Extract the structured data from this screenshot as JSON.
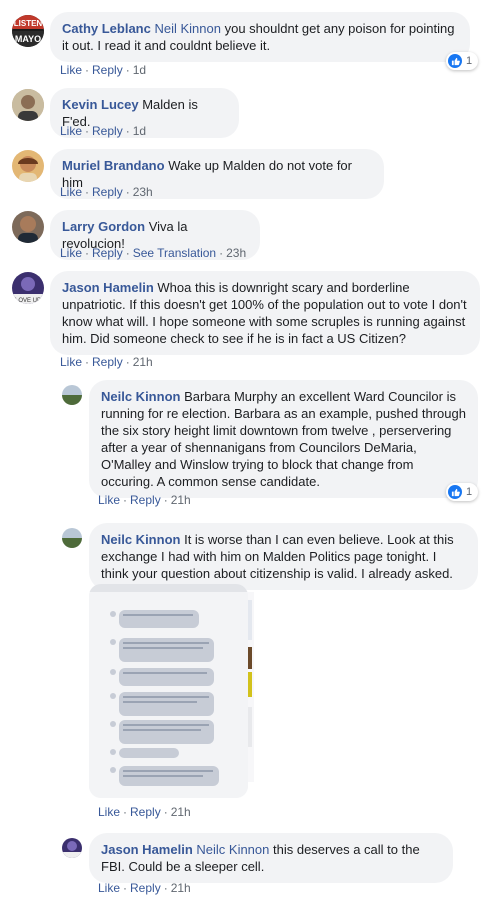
{
  "comments": [
    {
      "name": "Cathy Leblanc",
      "tag": "Neil Kinnon",
      "text": " you shouldnt get any poison for pointing it out. I read it and couldnt believe it.",
      "avatar_label": "LISTEN MAYO",
      "actions": [
        "Like",
        "Reply"
      ],
      "time": "1d",
      "reactions": {
        "icon": "like-icon",
        "count": "1"
      }
    },
    {
      "name": "Kevin Lucey",
      "text": "Malden is F'ed.",
      "actions": [
        "Like",
        "Reply"
      ],
      "time": "1d"
    },
    {
      "name": "Muriel Brandano",
      "text": "Wake up Malden do not vote for him",
      "actions": [
        "Like",
        "Reply"
      ],
      "time": "23h"
    },
    {
      "name": "Larry Gordon",
      "text": "Viva la revolucion!",
      "actions": [
        "Like",
        "Reply",
        "See Translation"
      ],
      "time": "23h"
    },
    {
      "name": "Jason Hamelin",
      "text": "Whoa this is downright scary and borderline unpatriotic. If this doesn't get 100% of the population out to vote I don't know what will. I hope someone with some scruples is running against him. Did someone check to see if he is in fact a US Citizen?",
      "avatar_label": "LOVE UP",
      "actions": [
        "Like",
        "Reply"
      ],
      "time": "21h"
    }
  ],
  "replies": [
    {
      "name": "Neilc Kinnon",
      "text": "Barbara Murphy an excellent Ward Councilor is running for re election. Barbara as an example, pushed through the six story height limit downtown from twelve , perservering after a year of shennanigans from Councilors DeMaria, O'Malley and Winslow trying to block that change from occuring. A common sense candidate.",
      "actions": [
        "Like",
        "Reply"
      ],
      "time": "21h",
      "reactions": {
        "icon": "like-icon",
        "count": "1"
      }
    },
    {
      "name": "Neilc Kinnon",
      "text": "It is worse than I can even believe. Look at this exchange I had with him on Malden Politics page tonight. I think your question about citizenship is valid. I already asked.",
      "actions": [
        "Like",
        "Reply"
      ],
      "time": "21h"
    },
    {
      "name": "Jason Hamelin",
      "tag": "Neilc Kinnon",
      "text": " this deserves a call to the FBI. Could be a sleeper cell.",
      "actions": [
        "Like",
        "Reply"
      ],
      "time": "21h"
    }
  ],
  "colors": {
    "link": "#385898",
    "bubble": "#f2f3f5",
    "meta": "#606770",
    "like": "#1877f2"
  }
}
